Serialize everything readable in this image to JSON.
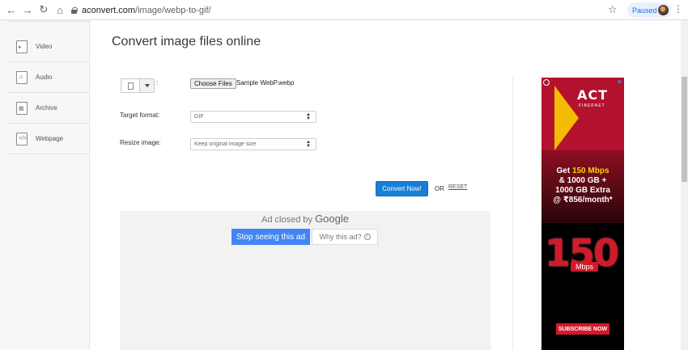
{
  "browser": {
    "url_host": "aconvert.com",
    "url_path": "/image/webp-to-gif/",
    "status_chip": "Paused",
    "icons": [
      "back-icon",
      "forward-icon",
      "reload-icon",
      "home-icon",
      "lock-icon",
      "star-icon",
      "menu-icon"
    ]
  },
  "sidebar": {
    "items": [
      {
        "label": "Video",
        "icon": "video-file-icon"
      },
      {
        "label": "Audio",
        "icon": "audio-file-icon"
      },
      {
        "label": "Archive",
        "icon": "archive-file-icon"
      },
      {
        "label": "Webpage",
        "icon": "webpage-file-icon"
      }
    ]
  },
  "main": {
    "title": "Convert image files online",
    "file_input": {
      "colon": ":",
      "button_label": "Choose Files",
      "selected_file": "Sample WebP.webp"
    },
    "target_format": {
      "label": "Target format:",
      "value": "GIF"
    },
    "resize": {
      "label": "Resize image:",
      "value": "Keep original image size"
    },
    "convert_label": "Convert Now!",
    "or_text": "OR",
    "reset_label": "RESET"
  },
  "closed_ad": {
    "text": "Ad closed by",
    "brand": "Google",
    "stop_label": "Stop seeing this ad",
    "why_label": "Why this ad?"
  },
  "side_ad": {
    "brand": "ACT",
    "brand_sub": "FIBERNET",
    "line1_pre": "Get ",
    "line1_hl": "150 Mbps",
    "line2": "& 1000 GB +",
    "line3": "1000 GB Extra",
    "line4": "@ ₹856/month",
    "line4_mark": "*",
    "big_number": "150",
    "unit": "Mbps",
    "cta": "SUBSCRIBE NOW"
  },
  "colors": {
    "convert_button": "#1a7ed6",
    "google_stop_button": "#4285f4",
    "ad_red": "#b3122e",
    "ad_highlight": "#ffd200"
  }
}
